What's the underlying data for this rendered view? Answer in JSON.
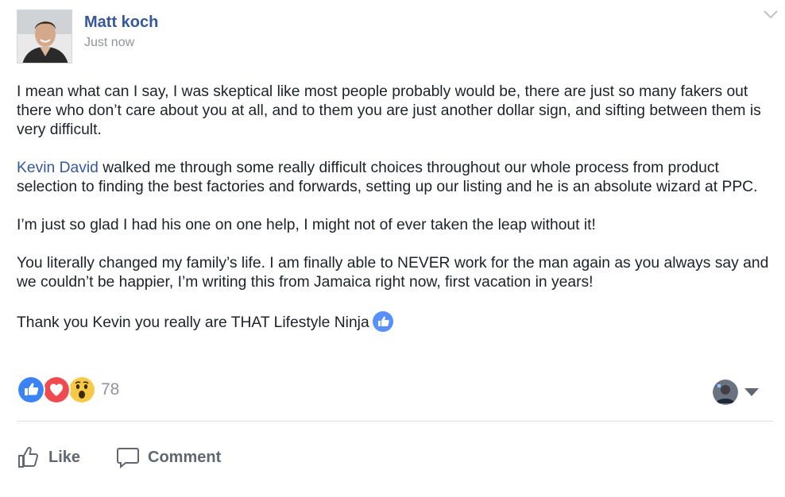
{
  "post": {
    "author": "Matt koch",
    "timestamp": "Just now",
    "paragraphs": [
      "I mean what can I say, I was skeptical like most people probably would be, there are just so many fakers out there who don’t care about you at all, and to them you are just another dollar sign, and sifting between them is very difficult.",
      "",
      "I’m just so glad I had his one on one help, I might not of ever taken the leap without it!",
      "You literally changed my family’s life. I am finally able to NEVER work for the man again as you always say and we couldn’t be happier, I’m writing this from Jamaica right now, first vacation in years!",
      "Thank you Kevin you really are THAT Lifestyle Ninja"
    ],
    "mention": "Kevin David",
    "mention_rest": " walked me through some really difficult choices throughout our whole process from product selection to finding the best factories and forwards, setting up our listing and he is an absolute wizard at PPC."
  },
  "reactions": {
    "icons": [
      "like-icon",
      "love-icon",
      "wow-icon"
    ],
    "count": "78"
  },
  "actions": {
    "like_label": "Like",
    "comment_label": "Comment"
  },
  "colors": {
    "link": "#365899",
    "like_blue": "#3b82f6",
    "love_red": "#f0494f",
    "wow_yellow": "#f7c944",
    "muted": "#90949c",
    "action_gray": "#606770"
  }
}
